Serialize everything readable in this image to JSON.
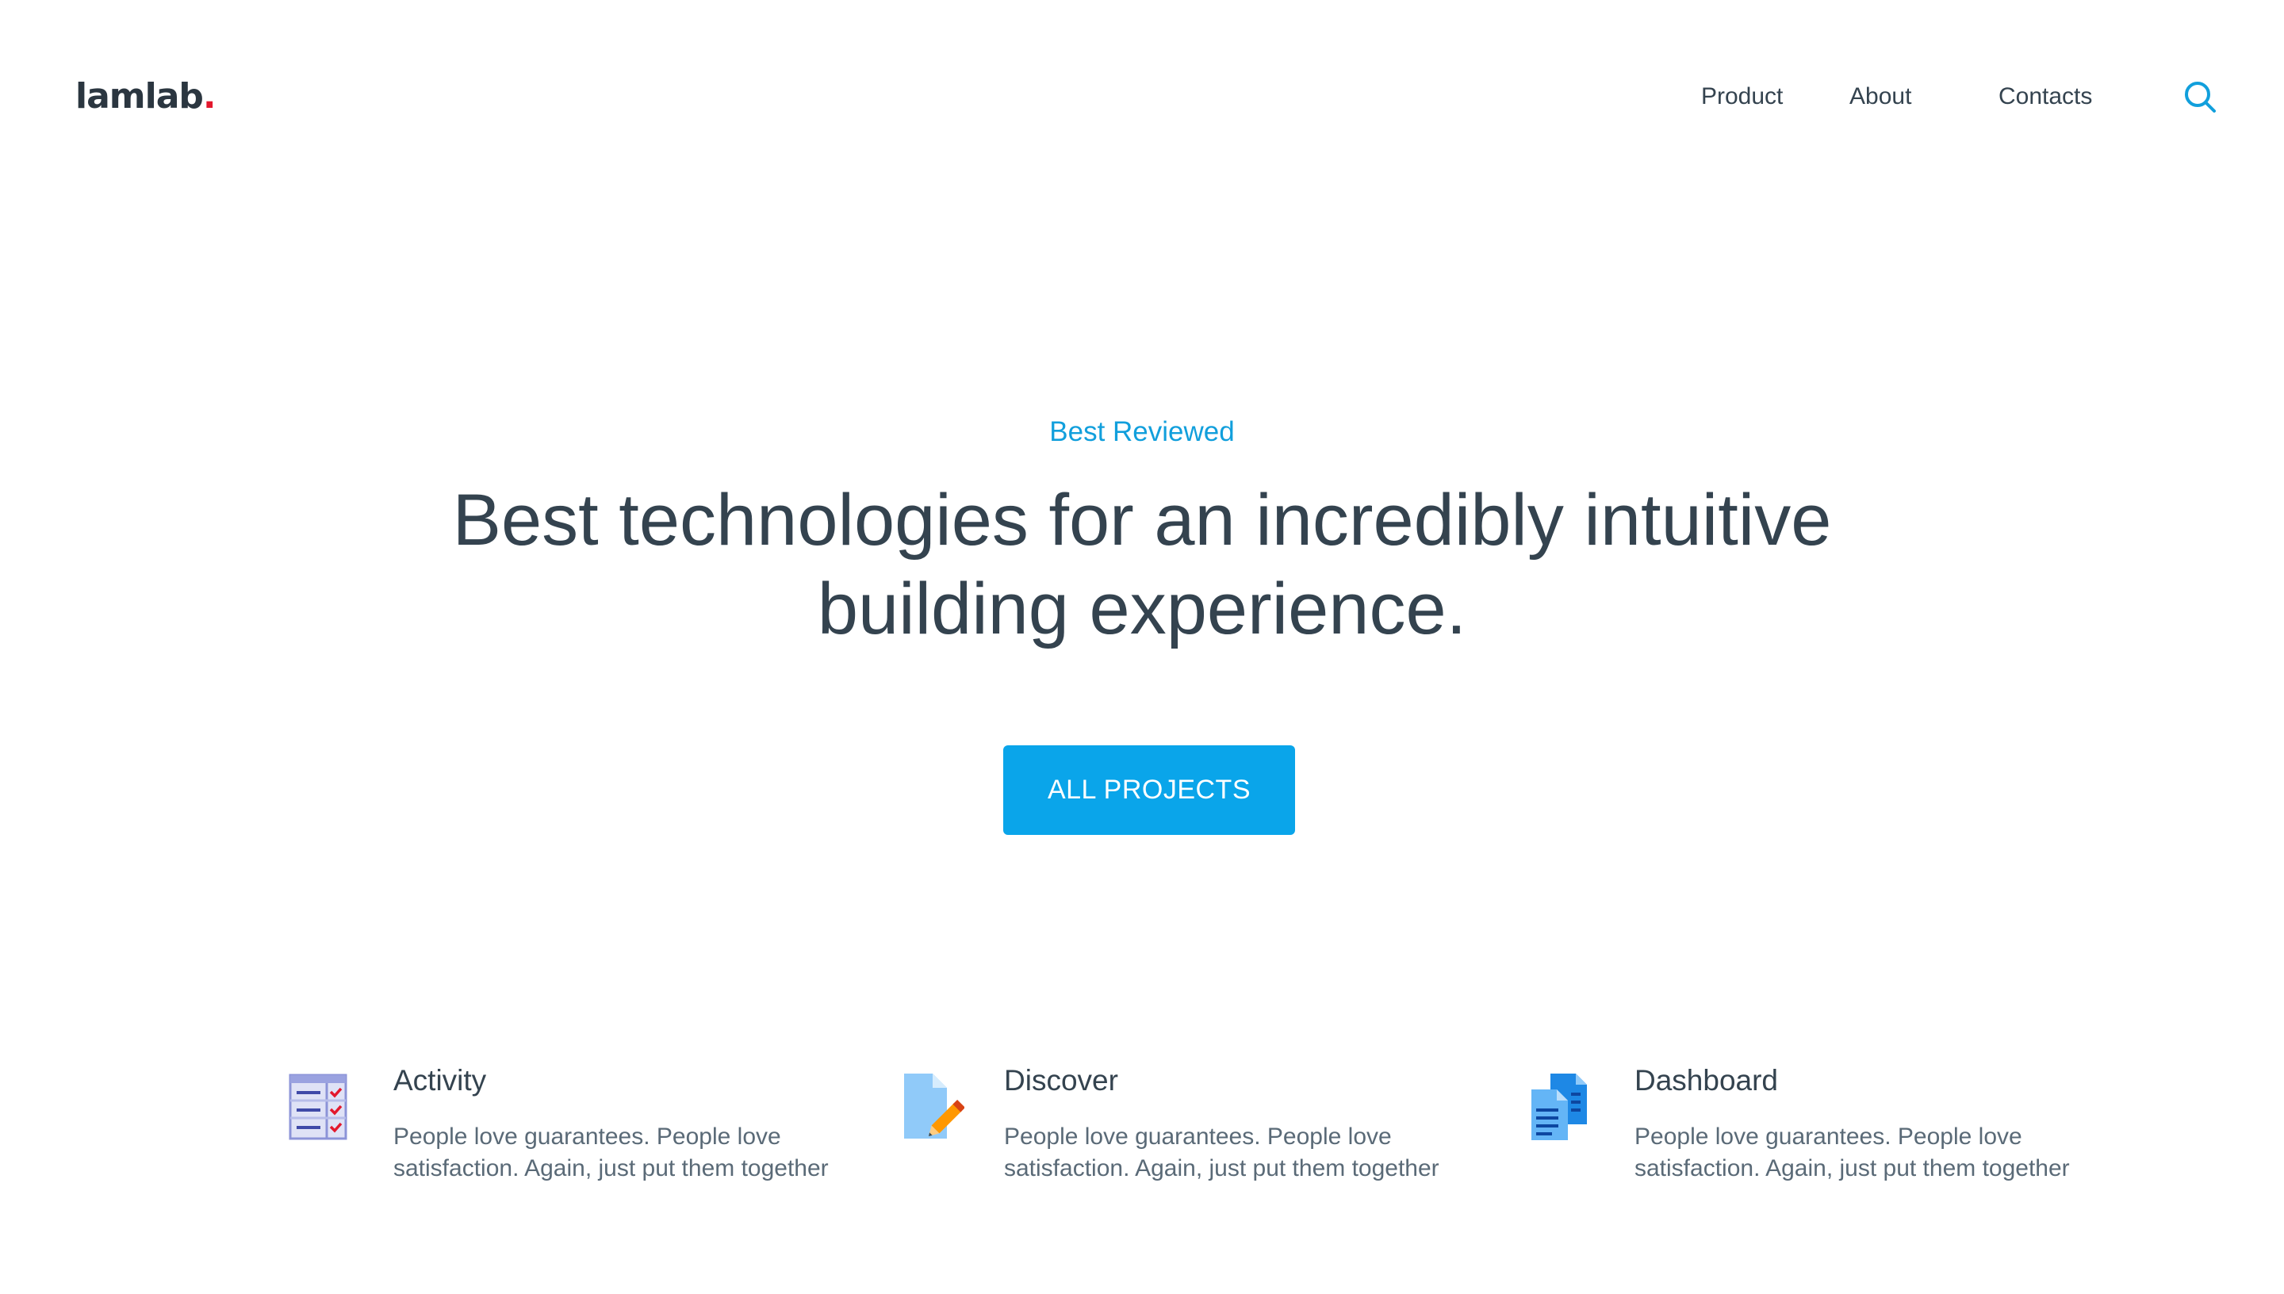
{
  "brand": {
    "name": "lamlab",
    "dot": ".",
    "accent_color": "#e3182d"
  },
  "nav": {
    "items": [
      "Product",
      "About",
      "Contacts"
    ],
    "search_icon": "search-icon"
  },
  "hero": {
    "eyebrow": "Best Reviewed",
    "headline": "Best technologies for an incredibly intuitive building experience.",
    "cta_label": "ALL PROJECTS",
    "accent_color": "#0aa5ea"
  },
  "features": [
    {
      "icon": "checklist-icon",
      "title": "Activity",
      "text": "People love guarantees. People love satisfaction. Again, just put them together"
    },
    {
      "icon": "document-edit-icon",
      "title": "Discover",
      "text": "People love guarantees. People love satisfaction. Again, just put them together"
    },
    {
      "icon": "documents-icon",
      "title": "Dashboard",
      "text": "People love guarantees. People love satisfaction. Again, just put them together"
    }
  ]
}
